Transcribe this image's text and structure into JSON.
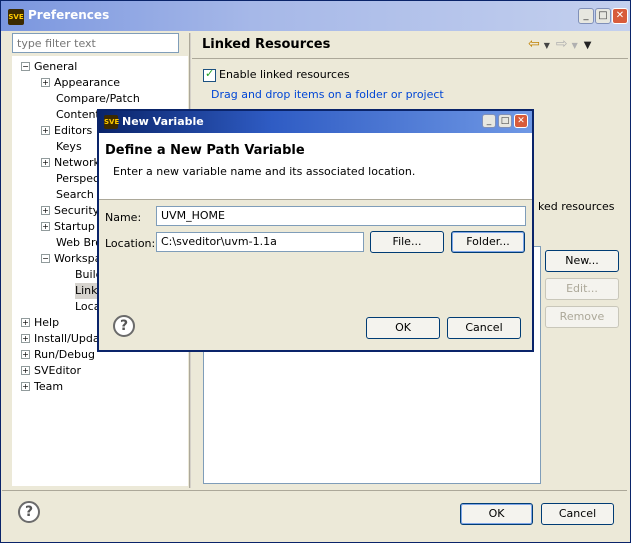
{
  "window": {
    "title": "Preferences",
    "icon": "SVE"
  },
  "filter": {
    "placeholder": "type filter text"
  },
  "tree": [
    {
      "label": "General",
      "expander": "−"
    },
    {
      "label": "Appearance",
      "expander": "+"
    },
    {
      "label": "Compare/Patch",
      "expander": ""
    },
    {
      "label": "Content",
      "expander": ""
    },
    {
      "label": "Editors",
      "expander": "+"
    },
    {
      "label": "Keys",
      "expander": ""
    },
    {
      "label": "Network",
      "expander": "+"
    },
    {
      "label": "Perspect",
      "expander": ""
    },
    {
      "label": "Search",
      "expander": ""
    },
    {
      "label": "Security",
      "expander": "+"
    },
    {
      "label": "Startup a",
      "expander": "+"
    },
    {
      "label": "Web Brow",
      "expander": ""
    },
    {
      "label": "Workspa",
      "expander": "−"
    },
    {
      "label": "Build",
      "expander": ""
    },
    {
      "label": "Linke",
      "expander": ""
    },
    {
      "label": "Loca",
      "expander": ""
    },
    {
      "label": "Help",
      "expander": "+"
    },
    {
      "label": "Install/Upda",
      "expander": "+"
    },
    {
      "label": "Run/Debug",
      "expander": "+"
    },
    {
      "label": "SVEditor",
      "expander": "+"
    },
    {
      "label": "Team",
      "expander": "+"
    }
  ],
  "page": {
    "title": "Linked Resources",
    "enable_label": "Enable linked resources",
    "drag_hint": "Drag and drop items on a folder or project",
    "linked_resources_fragment": "ked resources",
    "new_label": "New...",
    "edit_label": "Edit...",
    "remove_label": "Remove"
  },
  "footer": {
    "help_glyph": "?",
    "ok_label": "OK",
    "cancel_label": "Cancel"
  },
  "dialog": {
    "title": "New Variable",
    "icon": "SVE",
    "heading": "Define a New Path Variable",
    "description": "Enter a new variable name and its associated location.",
    "name_label": "Name:",
    "name_value": "UVM_HOME",
    "location_label": "Location:",
    "location_value": "C:\\sveditor\\uvm-1.1a",
    "file_label": "File...",
    "folder_label": "Folder...",
    "ok_label": "OK",
    "cancel_label": "Cancel",
    "help_glyph": "?"
  }
}
